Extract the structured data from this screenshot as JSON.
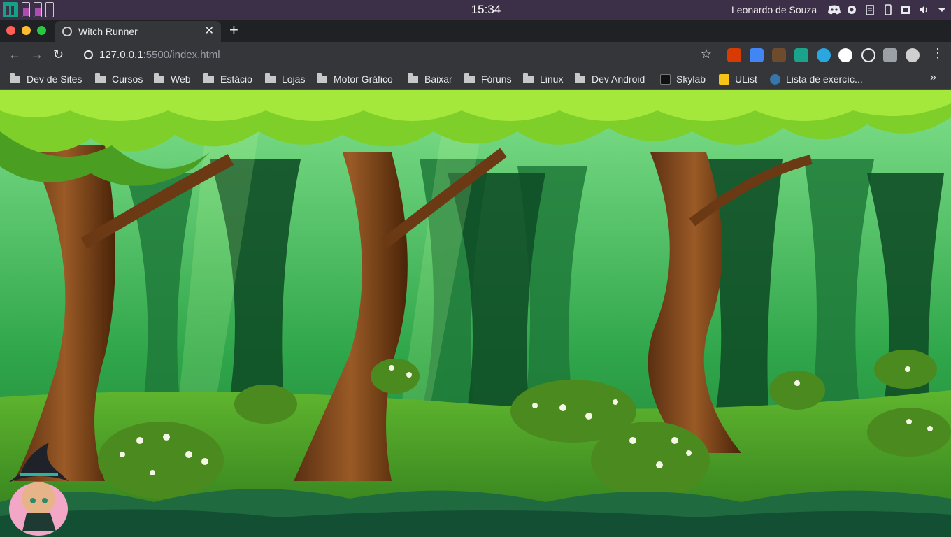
{
  "os": {
    "clock": "15:34",
    "user": "Leonardo de Souza",
    "icons": [
      "manjaro-logo-icon",
      "discord-icon",
      "settings-icon",
      "clipboard-icon",
      "phone-icon",
      "package-icon",
      "volume-icon",
      "chevron-down-icon"
    ]
  },
  "browser": {
    "tab": {
      "title": "Witch Runner"
    },
    "url": {
      "host": "127.0.0.1",
      "path": ":5500/index.html"
    },
    "bookmarks": [
      {
        "label": "Dev de Sites",
        "type": "folder"
      },
      {
        "label": "Cursos",
        "type": "folder"
      },
      {
        "label": "Web",
        "type": "folder"
      },
      {
        "label": "Estácio",
        "type": "folder"
      },
      {
        "label": "Lojas",
        "type": "folder"
      },
      {
        "label": "Motor Gráfico",
        "type": "folder"
      },
      {
        "label": "Baixar",
        "type": "folder"
      },
      {
        "label": "Fóruns",
        "type": "folder"
      },
      {
        "label": "Linux",
        "type": "folder"
      },
      {
        "label": "Dev Android",
        "type": "folder"
      },
      {
        "label": "Skylab",
        "type": "link"
      },
      {
        "label": "UList",
        "type": "link"
      },
      {
        "label": "Lista de exercíc...",
        "type": "link"
      }
    ],
    "more": "»"
  },
  "colors": {
    "os_panel": "#3c2f48",
    "tabstrip": "#202124",
    "toolbar": "#35363a",
    "close": "#ff5f57",
    "minimize": "#febc2e",
    "maximize": "#28c840"
  }
}
